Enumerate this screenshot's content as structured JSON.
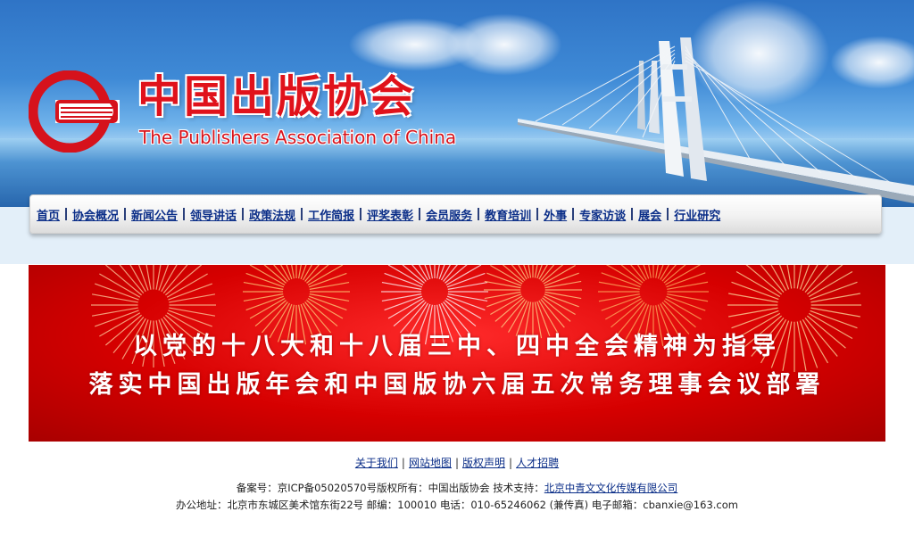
{
  "header": {
    "title_cn": "中国出版协会",
    "title_en": "The Publishers  Association  of China"
  },
  "nav": {
    "items": [
      {
        "label": "首页"
      },
      {
        "label": "协会概况"
      },
      {
        "label": "新闻公告"
      },
      {
        "label": "领导讲话"
      },
      {
        "label": "政策法规"
      },
      {
        "label": "工作简报"
      },
      {
        "label": "评奖表彰"
      },
      {
        "label": "会员服务"
      },
      {
        "label": "教育培训"
      },
      {
        "label": "外事"
      },
      {
        "label": "专家访谈"
      },
      {
        "label": "展会"
      },
      {
        "label": "行业研究"
      }
    ]
  },
  "banner": {
    "line1": "以党的十八大和十八届三中、四中全会精神为指导",
    "line2": "落实中国出版年会和中国版协六届五次常务理事会议部署"
  },
  "footer": {
    "links": [
      {
        "label": "关于我们"
      },
      {
        "label": "网站地图"
      },
      {
        "label": "版权声明"
      },
      {
        "label": "人才招聘"
      }
    ],
    "record_prefix": "备案号：京ICP备05020570号版权所有：中国出版协会 技术支持：",
    "tech_support_link": "北京中青文文化传媒有限公司",
    "address": "办公地址：北京市东城区美术馆东街22号 邮编：100010 电话：010-65246062 (兼传真) 电子邮箱：cbanxie@163.com"
  },
  "colors": {
    "brand_red": "#e0121b",
    "nav_link": "#0b2e88",
    "banner_red": "#d60000"
  }
}
